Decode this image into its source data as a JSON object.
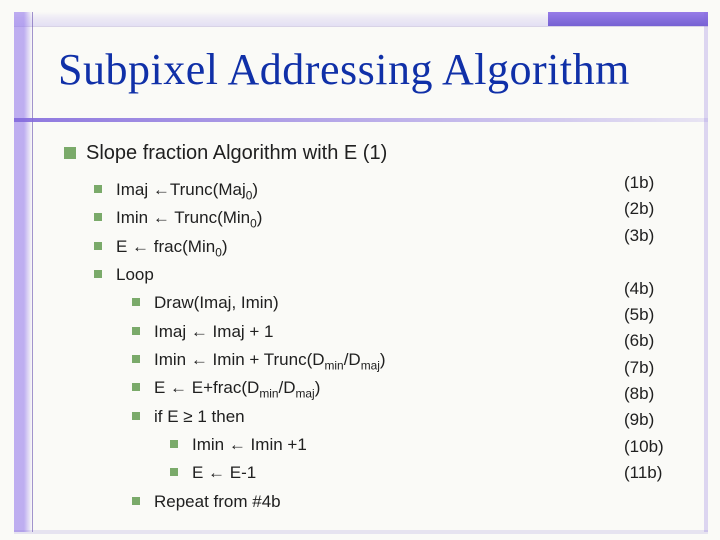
{
  "title": "Subpixel Addressing Algorithm",
  "heading": "Slope fraction Algorithm with E (1)",
  "lines": {
    "l1": {
      "text": "Imaj ←Trunc(Maj",
      "sub": "0",
      "tail": ")",
      "label": "(1b)"
    },
    "l2": {
      "text": "Imin ← Trunc(Min",
      "sub": "0",
      "tail": ")",
      "label": "(2b)"
    },
    "l3": {
      "text": "E ← frac(Min",
      "sub": "0",
      "tail": ")",
      "label": "(3b)"
    },
    "l4": {
      "text": "Loop",
      "label": ""
    },
    "l5": {
      "text": "Draw(Imaj, Imin)",
      "label": "(4b)"
    },
    "l6": {
      "text": "Imaj ← Imaj + 1",
      "label": "(5b)"
    },
    "l7": {
      "pre": "Imin ← Imin + Trunc(D",
      "sub1": "min",
      "mid": "/D",
      "sub2": "maj",
      "post": ")",
      "label": "(6b)"
    },
    "l8": {
      "pre": "E ← E+frac(D",
      "sub1": "min",
      "mid": "/D",
      "sub2": "maj",
      "post": ")",
      "label": "(7b)"
    },
    "l9": {
      "text": "if E ≥ 1 then",
      "label": "(8b)"
    },
    "l10": {
      "text": "Imin ← Imin +1",
      "label": "(9b)"
    },
    "l11": {
      "text": "E ← E-1",
      "label": "(10b)"
    },
    "l12": {
      "text": "Repeat from #4b",
      "label": "(11b)"
    }
  }
}
